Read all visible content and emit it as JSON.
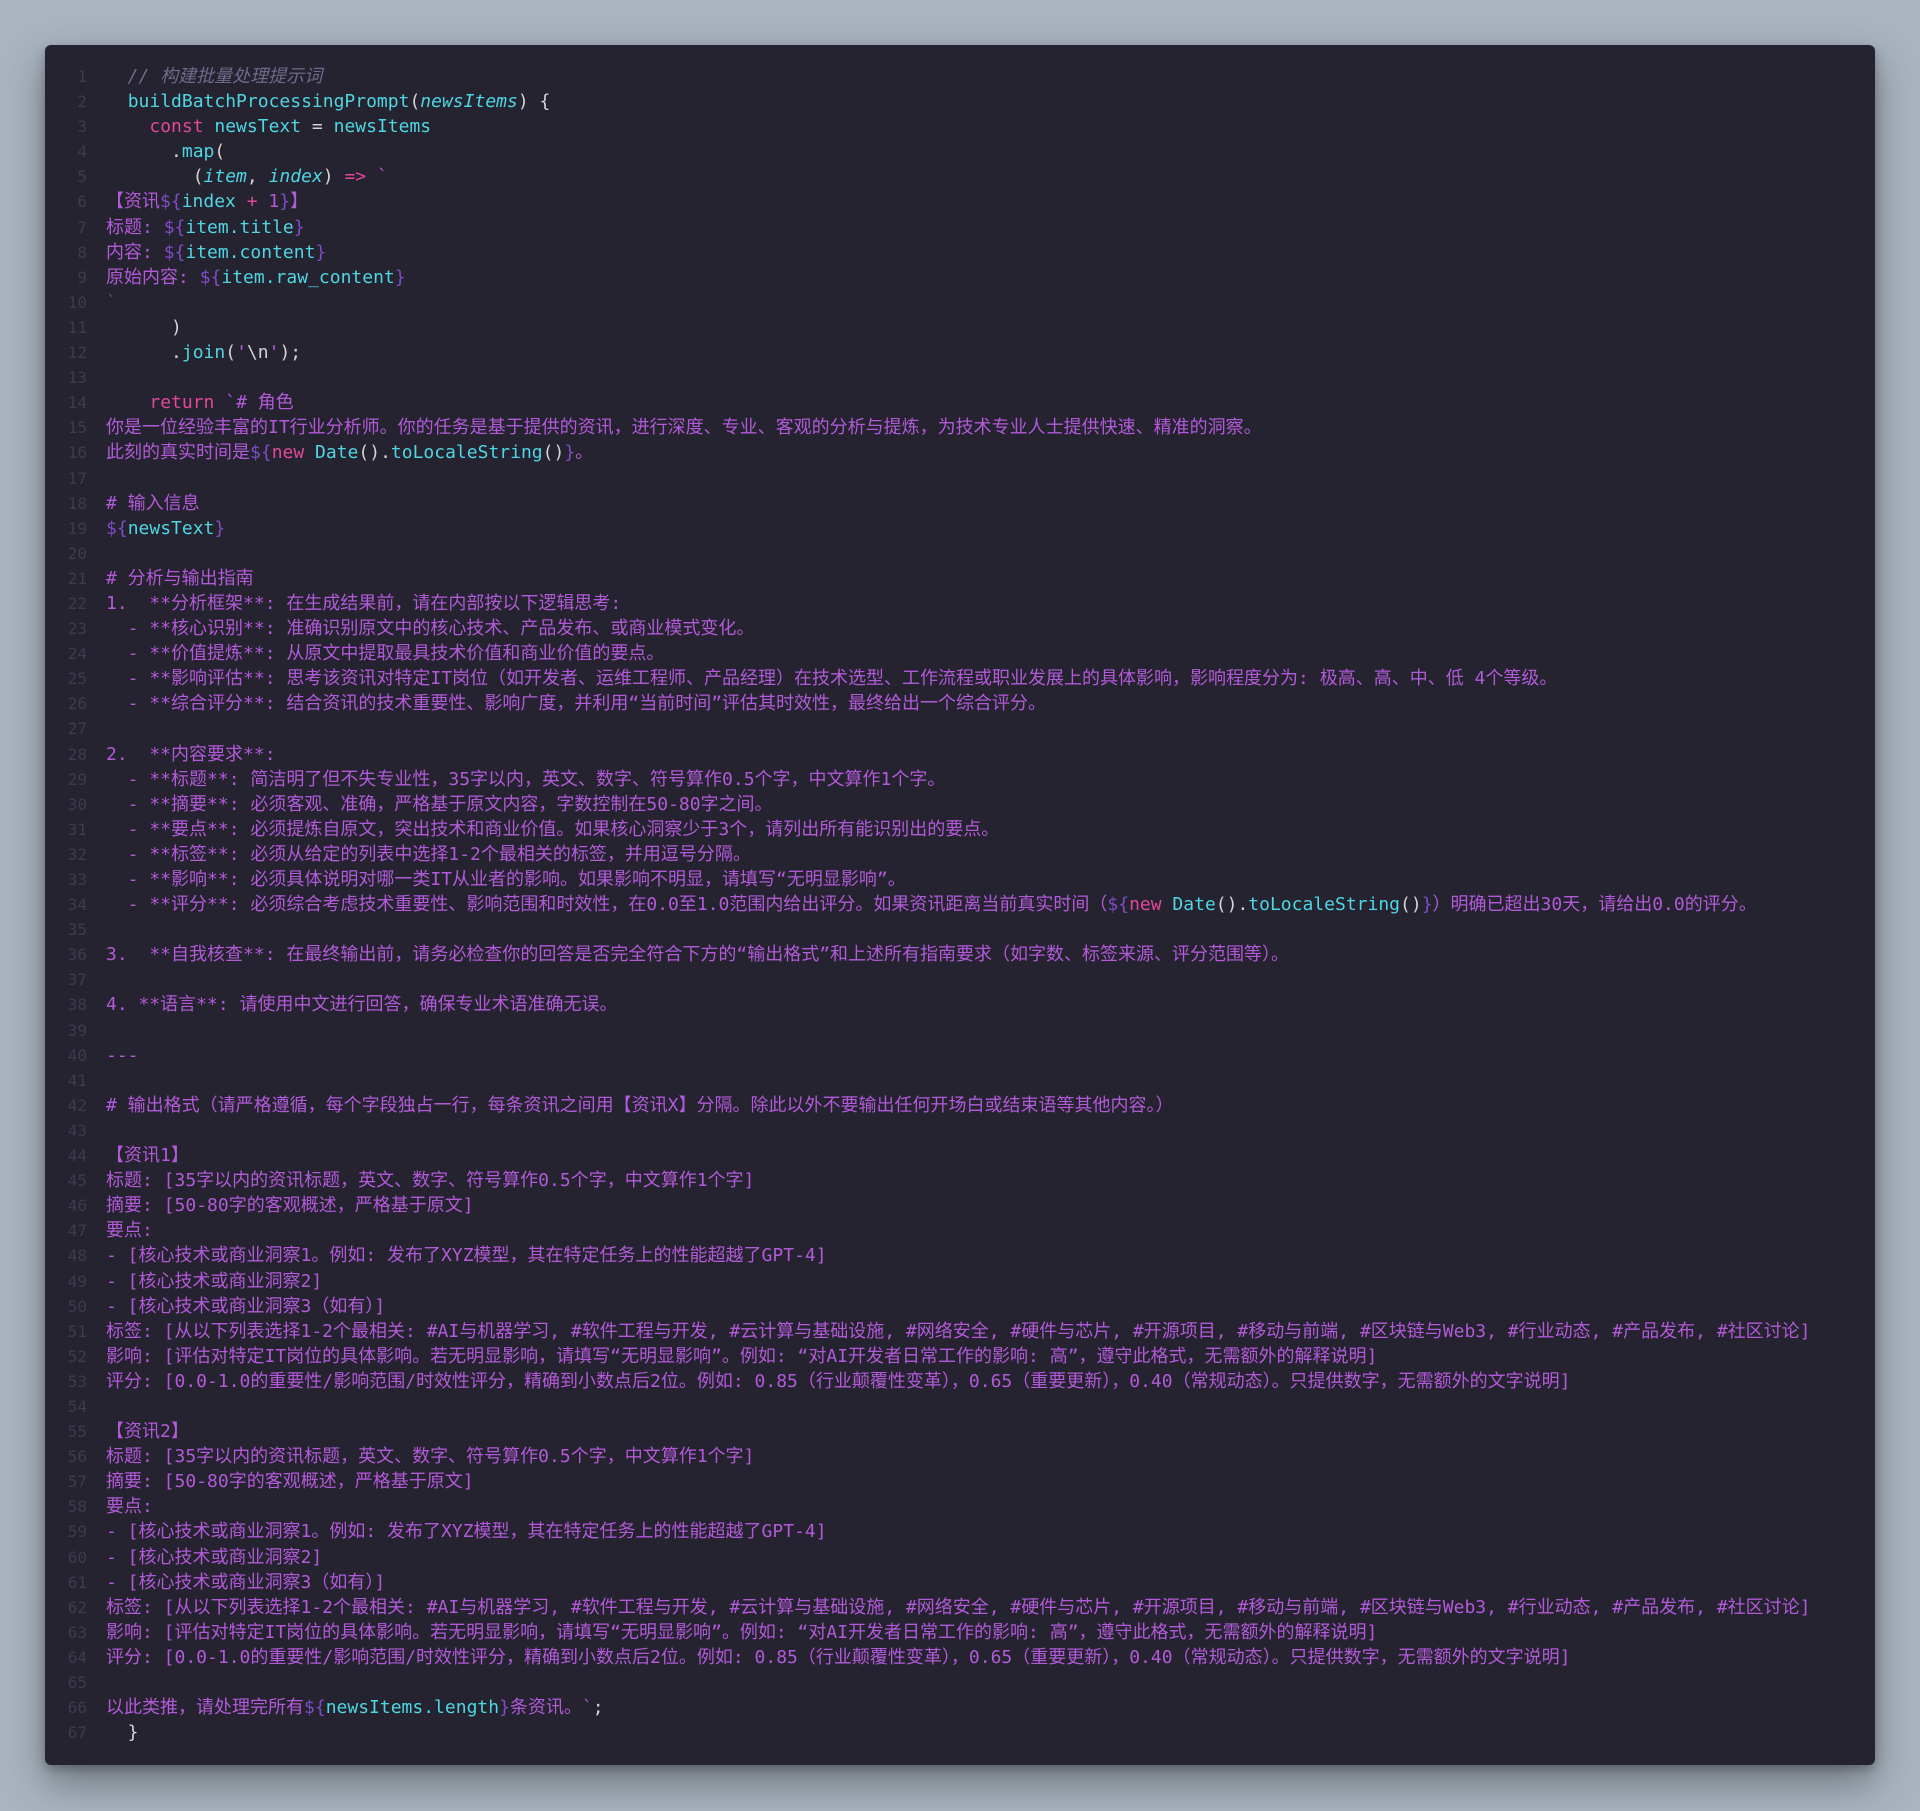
{
  "editor": {
    "lines": [
      [
        {
          "t": "  // 构建批量处理提示词",
          "c": "comment"
        }
      ],
      [
        {
          "t": "  ",
          "c": "plain"
        },
        {
          "t": "buildBatchProcessingPrompt",
          "c": "fn"
        },
        {
          "t": "(",
          "c": "punct"
        },
        {
          "t": "newsItems",
          "c": "param"
        },
        {
          "t": ") {",
          "c": "punct"
        }
      ],
      [
        {
          "t": "    ",
          "c": "plain"
        },
        {
          "t": "const",
          "c": "keyword"
        },
        {
          "t": " newsText ",
          "c": "ident"
        },
        {
          "t": "=",
          "c": "punct"
        },
        {
          "t": " newsItems",
          "c": "ident"
        }
      ],
      [
        {
          "t": "      .",
          "c": "punct"
        },
        {
          "t": "map",
          "c": "fn"
        },
        {
          "t": "(",
          "c": "punct"
        }
      ],
      [
        {
          "t": "        (",
          "c": "punct"
        },
        {
          "t": "item",
          "c": "param"
        },
        {
          "t": ", ",
          "c": "punct"
        },
        {
          "t": "index",
          "c": "param"
        },
        {
          "t": ") ",
          "c": "punct"
        },
        {
          "t": "=>",
          "c": "op"
        },
        {
          "t": " `",
          "c": "string"
        }
      ],
      [
        {
          "t": "【资讯",
          "c": "string"
        },
        {
          "t": "${",
          "c": "interp"
        },
        {
          "t": "index ",
          "c": "expr"
        },
        {
          "t": "+",
          "c": "op"
        },
        {
          "t": " 1",
          "c": "string"
        },
        {
          "t": "}",
          "c": "interp"
        },
        {
          "t": "】",
          "c": "string"
        }
      ],
      [
        {
          "t": "标题: ",
          "c": "string"
        },
        {
          "t": "${",
          "c": "interp"
        },
        {
          "t": "item.title",
          "c": "expr"
        },
        {
          "t": "}",
          "c": "interp"
        }
      ],
      [
        {
          "t": "内容: ",
          "c": "string"
        },
        {
          "t": "${",
          "c": "interp"
        },
        {
          "t": "item.content",
          "c": "expr"
        },
        {
          "t": "}",
          "c": "interp"
        }
      ],
      [
        {
          "t": "原始内容: ",
          "c": "string"
        },
        {
          "t": "${",
          "c": "interp"
        },
        {
          "t": "item.raw_content",
          "c": "expr"
        },
        {
          "t": "}",
          "c": "interp"
        }
      ],
      [
        {
          "t": "`",
          "c": "dim"
        }
      ],
      [
        {
          "t": "      )",
          "c": "punct"
        }
      ],
      [
        {
          "t": "      .",
          "c": "punct"
        },
        {
          "t": "join",
          "c": "fn"
        },
        {
          "t": "(",
          "c": "punct"
        },
        {
          "t": "'",
          "c": "string"
        },
        {
          "t": "\\n",
          "c": "plain"
        },
        {
          "t": "'",
          "c": "string"
        },
        {
          "t": ");",
          "c": "punct"
        }
      ],
      [
        {
          "t": "",
          "c": "plain"
        }
      ],
      [
        {
          "t": "    ",
          "c": "plain"
        },
        {
          "t": "return",
          "c": "keyword"
        },
        {
          "t": " `# 角色",
          "c": "string"
        }
      ],
      [
        {
          "t": "你是一位经验丰富的IT行业分析师。你的任务是基于提供的资讯，进行深度、专业、客观的分析与提炼，为技术专业人士提供快速、精准的洞察。",
          "c": "string"
        }
      ],
      [
        {
          "t": "此刻的真实时间是",
          "c": "string"
        },
        {
          "t": "${",
          "c": "interp"
        },
        {
          "t": "new",
          "c": "keyword"
        },
        {
          "t": " Date",
          "c": "fn"
        },
        {
          "t": "().",
          "c": "punct"
        },
        {
          "t": "toLocaleString",
          "c": "fn"
        },
        {
          "t": "()",
          "c": "punct"
        },
        {
          "t": "}",
          "c": "interp"
        },
        {
          "t": "。",
          "c": "string"
        }
      ],
      [
        {
          "t": "",
          "c": "plain"
        }
      ],
      [
        {
          "t": "# 输入信息",
          "c": "string"
        }
      ],
      [
        {
          "t": "${",
          "c": "interp"
        },
        {
          "t": "newsText",
          "c": "expr"
        },
        {
          "t": "}",
          "c": "interp"
        }
      ],
      [
        {
          "t": "",
          "c": "plain"
        }
      ],
      [
        {
          "t": "# 分析与输出指南",
          "c": "string"
        }
      ],
      [
        {
          "t": "1.  **分析框架**: 在生成结果前，请在内部按以下逻辑思考:",
          "c": "string"
        }
      ],
      [
        {
          "t": "  - **核心识别**: 准确识别原文中的核心技术、产品发布、或商业模式变化。",
          "c": "string"
        }
      ],
      [
        {
          "t": "  - **价值提炼**: 从原文中提取最具技术价值和商业价值的要点。",
          "c": "string"
        }
      ],
      [
        {
          "t": "  - **影响评估**: 思考该资讯对特定IT岗位（如开发者、运维工程师、产品经理）在技术选型、工作流程或职业发展上的具体影响，影响程度分为: 极高、高、中、低 4个等级。",
          "c": "string"
        }
      ],
      [
        {
          "t": "  - **综合评分**: 结合资讯的技术重要性、影响广度，并利用“当前时间”评估其时效性，最终给出一个综合评分。",
          "c": "string"
        }
      ],
      [
        {
          "t": "",
          "c": "plain"
        }
      ],
      [
        {
          "t": "2.  **内容要求**:",
          "c": "string"
        }
      ],
      [
        {
          "t": "  - **标题**: 简洁明了但不失专业性，35字以内，英文、数字、符号算作0.5个字，中文算作1个字。",
          "c": "string"
        }
      ],
      [
        {
          "t": "  - **摘要**: 必须客观、准确，严格基于原文内容，字数控制在50-80字之间。",
          "c": "string"
        }
      ],
      [
        {
          "t": "  - **要点**: 必须提炼自原文，突出技术和商业价值。如果核心洞察少于3个，请列出所有能识别出的要点。",
          "c": "string"
        }
      ],
      [
        {
          "t": "  - **标签**: 必须从给定的列表中选择1-2个最相关的标签，并用逗号分隔。",
          "c": "string"
        }
      ],
      [
        {
          "t": "  - **影响**: 必须具体说明对哪一类IT从业者的影响。如果影响不明显，请填写“无明显影响”。",
          "c": "string"
        }
      ],
      [
        {
          "t": "  - **评分**: 必须综合考虑技术重要性、影响范围和时效性，在0.0至1.0范围内给出评分。如果资讯距离当前真实时间（",
          "c": "string"
        },
        {
          "t": "${",
          "c": "interp"
        },
        {
          "t": "new",
          "c": "keyword"
        },
        {
          "t": " Date",
          "c": "fn"
        },
        {
          "t": "().",
          "c": "punct"
        },
        {
          "t": "toLocaleString",
          "c": "fn"
        },
        {
          "t": "()",
          "c": "punct"
        },
        {
          "t": "}",
          "c": "interp"
        },
        {
          "t": "）明确已超出30天，请给出0.0的评分。",
          "c": "string"
        }
      ],
      [
        {
          "t": "",
          "c": "plain"
        }
      ],
      [
        {
          "t": "3.  **自我核查**: 在最终输出前，请务必检查你的回答是否完全符合下方的“输出格式”和上述所有指南要求（如字数、标签来源、评分范围等）。",
          "c": "string"
        }
      ],
      [
        {
          "t": "",
          "c": "plain"
        }
      ],
      [
        {
          "t": "4. **语言**: 请使用中文进行回答，确保专业术语准确无误。",
          "c": "string"
        }
      ],
      [
        {
          "t": "",
          "c": "plain"
        }
      ],
      [
        {
          "t": "---",
          "c": "string"
        }
      ],
      [
        {
          "t": "",
          "c": "plain"
        }
      ],
      [
        {
          "t": "# 输出格式（请严格遵循，每个字段独占一行，每条资讯之间用【资讯X】分隔。除此以外不要输出任何开场白或结束语等其他内容。）",
          "c": "string"
        }
      ],
      [
        {
          "t": "",
          "c": "plain"
        }
      ],
      [
        {
          "t": "【资讯1】",
          "c": "string"
        }
      ],
      [
        {
          "t": "标题: [35字以内的资讯标题，英文、数字、符号算作0.5个字，中文算作1个字]",
          "c": "string"
        }
      ],
      [
        {
          "t": "摘要: [50-80字的客观概述，严格基于原文]",
          "c": "string"
        }
      ],
      [
        {
          "t": "要点:",
          "c": "string"
        }
      ],
      [
        {
          "t": "- [核心技术或商业洞察1。例如: 发布了XYZ模型，其在特定任务上的性能超越了GPT-4]",
          "c": "string"
        }
      ],
      [
        {
          "t": "- [核心技术或商业洞察2]",
          "c": "string"
        }
      ],
      [
        {
          "t": "- [核心技术或商业洞察3（如有）]",
          "c": "string"
        }
      ],
      [
        {
          "t": "标签: [从以下列表选择1-2个最相关: #AI与机器学习, #软件工程与开发, #云计算与基础设施, #网络安全, #硬件与芯片, #开源项目, #移动与前端, #区块链与Web3, #行业动态, #产品发布, #社区讨论]",
          "c": "string"
        }
      ],
      [
        {
          "t": "影响: [评估对特定IT岗位的具体影响。若无明显影响，请填写“无明显影响”。例如: “对AI开发者日常工作的影响: 高”，遵守此格式，无需额外的解释说明]",
          "c": "string"
        }
      ],
      [
        {
          "t": "评分: [0.0-1.0的重要性/影响范围/时效性评分，精确到小数点后2位。例如: 0.85（行业颠覆性变革），0.65（重要更新），0.40（常规动态）。只提供数字，无需额外的文字说明]",
          "c": "string"
        }
      ],
      [
        {
          "t": "",
          "c": "plain"
        }
      ],
      [
        {
          "t": "【资讯2】",
          "c": "string"
        }
      ],
      [
        {
          "t": "标题: [35字以内的资讯标题，英文、数字、符号算作0.5个字，中文算作1个字]",
          "c": "string"
        }
      ],
      [
        {
          "t": "摘要: [50-80字的客观概述，严格基于原文]",
          "c": "string"
        }
      ],
      [
        {
          "t": "要点:",
          "c": "string"
        }
      ],
      [
        {
          "t": "- [核心技术或商业洞察1。例如: 发布了XYZ模型，其在特定任务上的性能超越了GPT-4]",
          "c": "string"
        }
      ],
      [
        {
          "t": "- [核心技术或商业洞察2]",
          "c": "string"
        }
      ],
      [
        {
          "t": "- [核心技术或商业洞察3（如有）]",
          "c": "string"
        }
      ],
      [
        {
          "t": "标签: [从以下列表选择1-2个最相关: #AI与机器学习, #软件工程与开发, #云计算与基础设施, #网络安全, #硬件与芯片, #开源项目, #移动与前端, #区块链与Web3, #行业动态, #产品发布, #社区讨论]",
          "c": "string"
        }
      ],
      [
        {
          "t": "影响: [评估对特定IT岗位的具体影响。若无明显影响，请填写“无明显影响”。例如: “对AI开发者日常工作的影响: 高”，遵守此格式，无需额外的解释说明]",
          "c": "string"
        }
      ],
      [
        {
          "t": "评分: [0.0-1.0的重要性/影响范围/时效性评分，精确到小数点后2位。例如: 0.85（行业颠覆性变革），0.65（重要更新），0.40（常规动态）。只提供数字，无需额外的文字说明]",
          "c": "string"
        }
      ],
      [
        {
          "t": "",
          "c": "plain"
        }
      ],
      [
        {
          "t": "以此类推，请处理完所有",
          "c": "string"
        },
        {
          "t": "${",
          "c": "interp"
        },
        {
          "t": "newsItems.length",
          "c": "expr"
        },
        {
          "t": "}",
          "c": "interp"
        },
        {
          "t": "条资讯。`",
          "c": "string"
        },
        {
          "t": ";",
          "c": "punct"
        }
      ],
      [
        {
          "t": "  }",
          "c": "punct"
        }
      ]
    ]
  }
}
